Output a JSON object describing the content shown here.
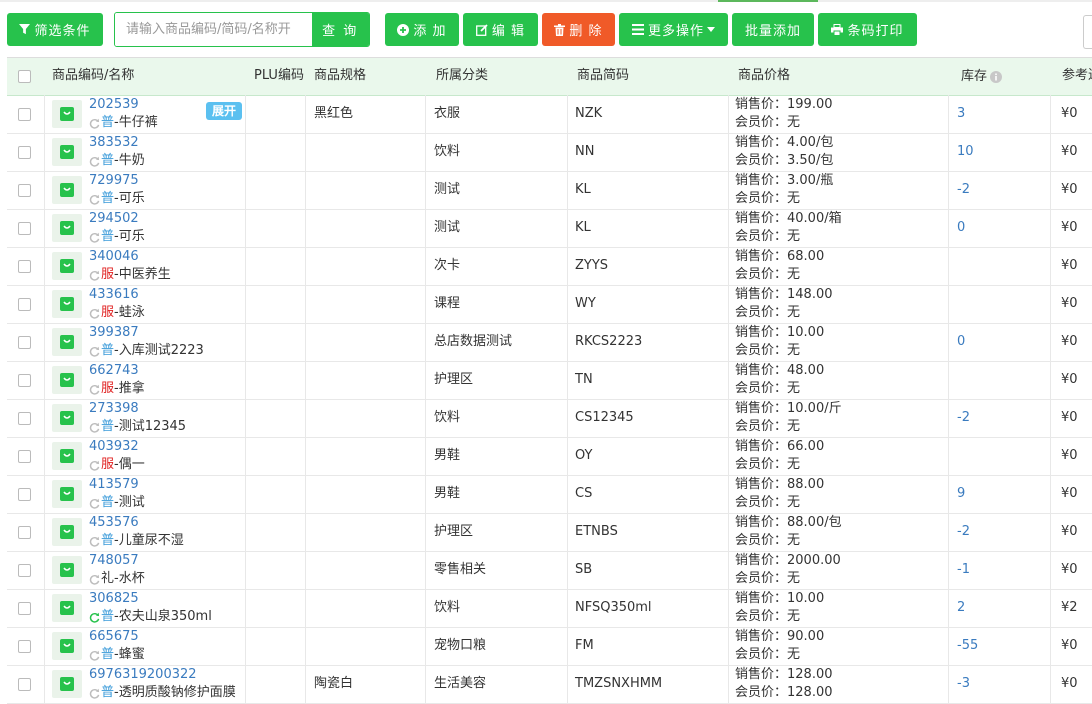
{
  "toolbar": {
    "filter_label": "筛选条件",
    "search_placeholder": "请输入商品编码/简码/名称开",
    "search_button": "查 询",
    "add_label": "添 加",
    "edit_label": "编 辑",
    "delete_label": "删 除",
    "more_label": "更多操作",
    "batch_add_label": "批量添加",
    "barcode_print_label": "条码打印"
  },
  "colors": {
    "accent_green": "#27c24c",
    "delete_orange": "#f05a28",
    "link_blue": "#3a7bbf",
    "expand_blue": "#5bc0f0"
  },
  "table": {
    "columns": {
      "code_name": "商品编码/名称",
      "plu": "PLU编码",
      "spec": "商品规格",
      "category": "所属分类",
      "short_code": "商品简码",
      "price": "商品价格",
      "stock": "库存",
      "ref": "参考进价"
    },
    "expand_label": "展开",
    "rows": [
      {
        "code": "202539",
        "tag": "普",
        "name": "牛仔裤",
        "spec": "黑红色",
        "category": "衣服",
        "short": "NZK",
        "sale": "销售价：199.00",
        "member": "会员价：无",
        "stock": "3",
        "ref": "¥0"
      },
      {
        "code": "383532",
        "tag": "普",
        "name": "牛奶",
        "spec": "",
        "category": "饮料",
        "short": "NN",
        "sale": "销售价：4.00/包",
        "member": "会员价：3.50/包",
        "stock": "10",
        "ref": "¥0"
      },
      {
        "code": "729975",
        "tag": "普",
        "name": "可乐",
        "spec": "",
        "category": "测试",
        "short": "KL",
        "sale": "销售价：3.00/瓶",
        "member": "会员价：无",
        "stock": "-2",
        "ref": "¥0"
      },
      {
        "code": "294502",
        "tag": "普",
        "name": "可乐",
        "spec": "",
        "category": "测试",
        "short": "KL",
        "sale": "销售价：40.00/箱",
        "member": "会员价：无",
        "stock": "0",
        "ref": "¥0"
      },
      {
        "code": "340046",
        "tag": "服",
        "name": "中医养生",
        "spec": "",
        "category": "次卡",
        "short": "ZYYS",
        "sale": "销售价：68.00",
        "member": "会员价：无",
        "stock": "",
        "ref": "¥0"
      },
      {
        "code": "433616",
        "tag": "服",
        "name": "蛙泳",
        "spec": "",
        "category": "课程",
        "short": "WY",
        "sale": "销售价：148.00",
        "member": "会员价：无",
        "stock": "",
        "ref": "¥0"
      },
      {
        "code": "399387",
        "tag": "普",
        "name": "入库测试2223",
        "spec": "",
        "category": "总店数据测试",
        "short": "RKCS2223",
        "sale": "销售价：10.00",
        "member": "会员价：无",
        "stock": "0",
        "ref": "¥0"
      },
      {
        "code": "662743",
        "tag": "服",
        "name": "推拿",
        "spec": "",
        "category": "护理区",
        "short": "TN",
        "sale": "销售价：48.00",
        "member": "会员价：无",
        "stock": "",
        "ref": "¥0"
      },
      {
        "code": "273398",
        "tag": "普",
        "name": "测试12345",
        "spec": "",
        "category": "饮料",
        "short": "CS12345",
        "sale": "销售价：10.00/斤",
        "member": "会员价：无",
        "stock": "-2",
        "ref": "¥0"
      },
      {
        "code": "403932",
        "tag": "服",
        "name": "偶一",
        "spec": "",
        "category": "男鞋",
        "short": "OY",
        "sale": "销售价：66.00",
        "member": "会员价：无",
        "stock": "",
        "ref": "¥0"
      },
      {
        "code": "413579",
        "tag": "普",
        "name": "测试",
        "spec": "",
        "category": "男鞋",
        "short": "CS",
        "sale": "销售价：88.00",
        "member": "会员价：无",
        "stock": "9",
        "ref": "¥0"
      },
      {
        "code": "453576",
        "tag": "普",
        "name": "儿童尿不湿",
        "spec": "",
        "category": "护理区",
        "short": "ETNBS",
        "sale": "销售价：88.00/包",
        "member": "会员价：无",
        "stock": "-2",
        "ref": "¥0"
      },
      {
        "code": "748057",
        "tag": "礼",
        "name": "水杯",
        "spec": "",
        "category": "零售相关",
        "short": "SB",
        "sale": "销售价：2000.00",
        "member": "会员价：无",
        "stock": "-1",
        "ref": "¥0"
      },
      {
        "code": "306825",
        "tag": "普",
        "name": "农夫山泉350ml",
        "spec": "",
        "category": "饮料",
        "short": "NFSQ350ml",
        "sale": "销售价：10.00",
        "member": "会员价：无",
        "stock": "2",
        "ref": "¥2"
      },
      {
        "code": "665675",
        "tag": "普",
        "name": "蜂蜜",
        "spec": "",
        "category": "宠物口粮",
        "short": "FM",
        "sale": "销售价：90.00",
        "member": "会员价：无",
        "stock": "-55",
        "ref": "¥0"
      },
      {
        "code": "6976319200322",
        "tag": "普",
        "name": "透明质酸钠修护面膜",
        "spec": "陶瓷白",
        "category": "生活美容",
        "short": "TMZSNXHMM",
        "sale": "销售价：128.00",
        "member": "会员价：128.00",
        "stock": "-3",
        "ref": "¥0"
      }
    ]
  }
}
